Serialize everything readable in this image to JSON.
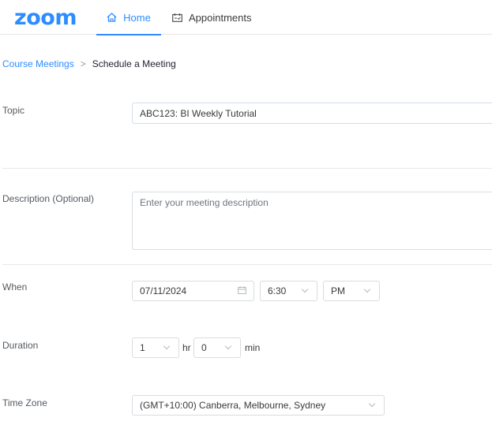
{
  "header": {
    "logo_text": "zoom",
    "nav": [
      {
        "label": "Home",
        "icon": "home-icon",
        "active": true
      },
      {
        "label": "Appointments",
        "icon": "calendar-icon",
        "active": false
      }
    ]
  },
  "breadcrumb": {
    "parent": "Course Meetings",
    "separator": ">",
    "current": "Schedule a Meeting"
  },
  "form": {
    "topic": {
      "label": "Topic",
      "value": "ABC123: BI Weekly Tutorial"
    },
    "description": {
      "label": "Description (Optional)",
      "placeholder": "Enter your meeting description",
      "value": ""
    },
    "when": {
      "label": "When",
      "date": "07/11/2024",
      "time": "6:30",
      "ampm": "PM"
    },
    "duration": {
      "label": "Duration",
      "hours": "1",
      "hours_unit": "hr",
      "minutes": "0",
      "minutes_unit": "min"
    },
    "timezone": {
      "label": "Time Zone",
      "value": "(GMT+10:00) Canberra, Melbourne, Sydney"
    }
  },
  "colors": {
    "brand": "#2D8CFF"
  }
}
